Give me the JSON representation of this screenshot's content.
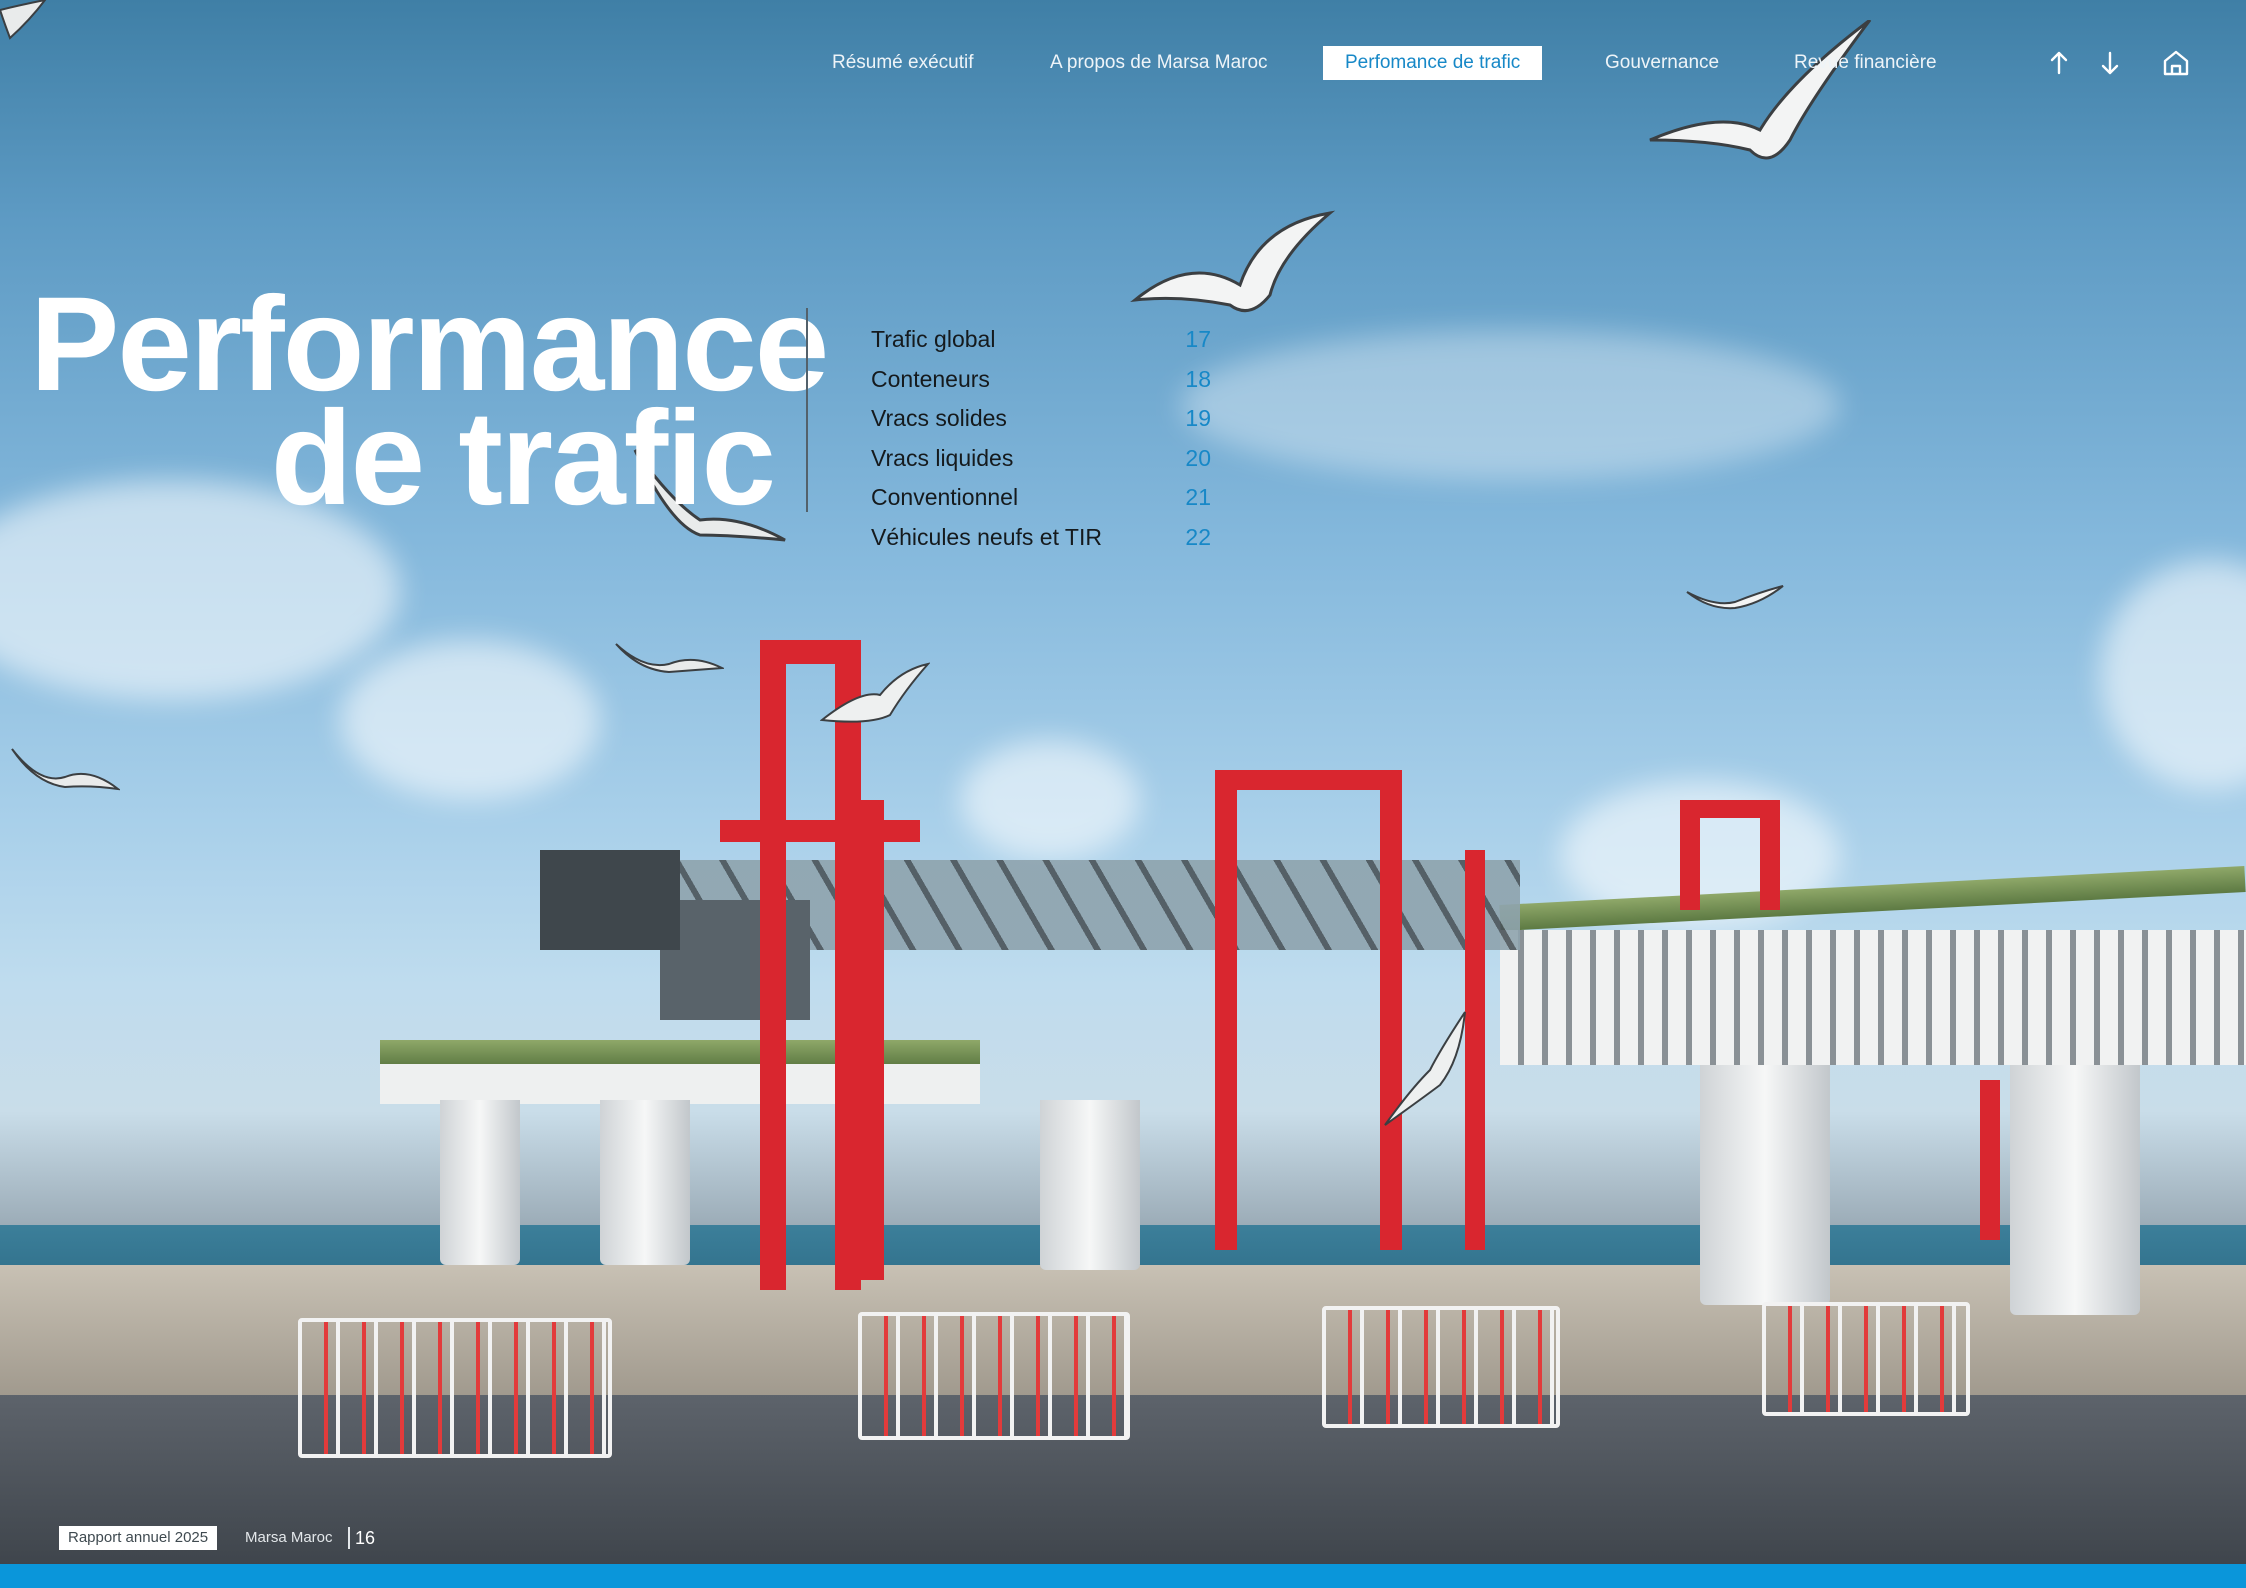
{
  "nav": {
    "items": [
      {
        "label": "Résumé exécutif",
        "active": false
      },
      {
        "label": "A propos de Marsa Maroc",
        "active": false
      },
      {
        "label": "Perfomance de trafic",
        "active": true
      },
      {
        "label": "Gouvernance",
        "active": false
      },
      {
        "label": "Revue financière",
        "active": false
      }
    ],
    "icons": [
      "arrow-up-icon",
      "arrow-down-icon",
      "home-icon"
    ]
  },
  "hero": {
    "title_line1": "Performance",
    "title_line2": "de trafic"
  },
  "toc": [
    {
      "label": "Trafic global",
      "page": "17"
    },
    {
      "label": "Conteneurs",
      "page": "18"
    },
    {
      "label": "Vracs solides",
      "page": "19"
    },
    {
      "label": "Vracs liquides",
      "page": "20"
    },
    {
      "label": "Conventionnel",
      "page": "21"
    },
    {
      "label": "Véhicules neufs et TIR",
      "page": "22"
    }
  ],
  "footer": {
    "report": "Rapport annuel 2025",
    "company": "Marsa Maroc",
    "page_number": "16"
  },
  "colors": {
    "accent": "#1788c7",
    "bottom_bar": "#0a96da",
    "crane_red": "#d9262f"
  }
}
